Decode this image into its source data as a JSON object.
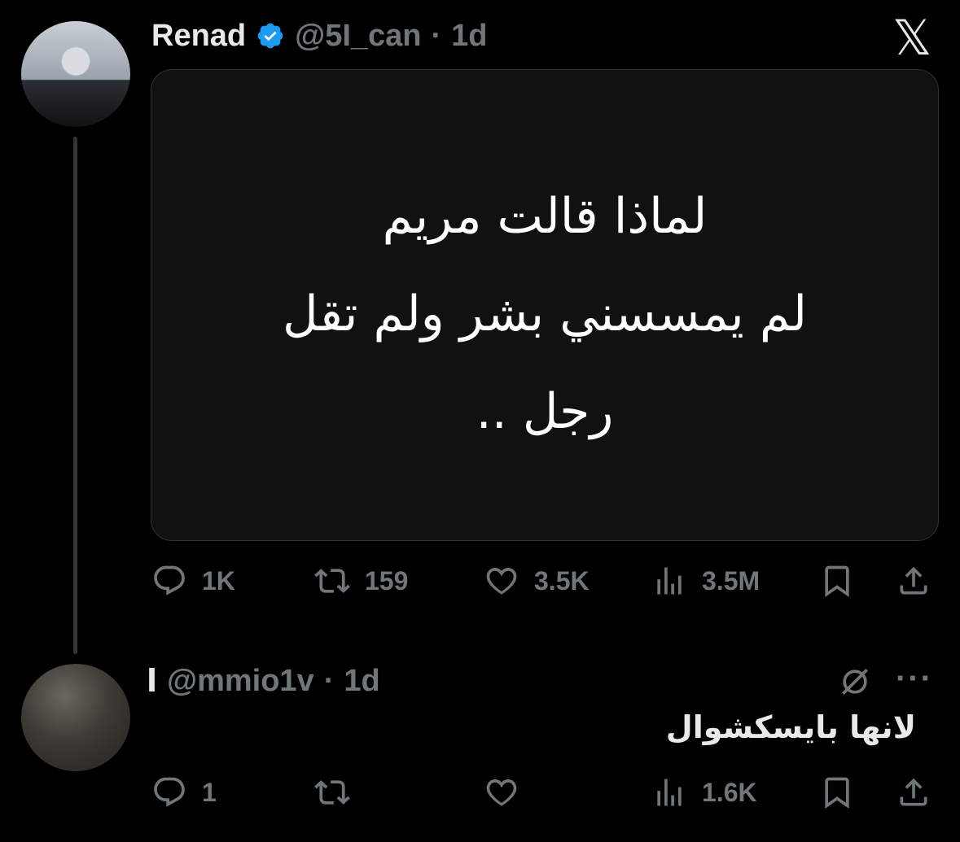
{
  "tweet": {
    "author_name": "Renad",
    "author_handle": "@5I_can",
    "separator": "·",
    "time": "1d",
    "image_text_lines": [
      "لماذا قالت مريم",
      "لم يمسسني بشر ولم تقل",
      "رجل .."
    ],
    "stats": {
      "replies": "1K",
      "reposts": "159",
      "likes": "3.5K",
      "views": "3.5M"
    }
  },
  "reply": {
    "author_name": "ا",
    "author_handle": "@mmio1v",
    "separator": "·",
    "time": "1d",
    "text": "لانها بايسكشوال",
    "stats": {
      "replies": "1",
      "views": "1.6K"
    }
  },
  "colors": {
    "background": "#000000",
    "text": "#e7e9ea",
    "muted": "#71767b",
    "verified_blue": "#1d9bf0"
  },
  "icons": [
    "x-logo-icon",
    "verified-badge-icon",
    "reply-icon",
    "repost-icon",
    "like-icon",
    "views-icon",
    "bookmark-icon",
    "share-icon",
    "grok-icon",
    "more-icon"
  ]
}
